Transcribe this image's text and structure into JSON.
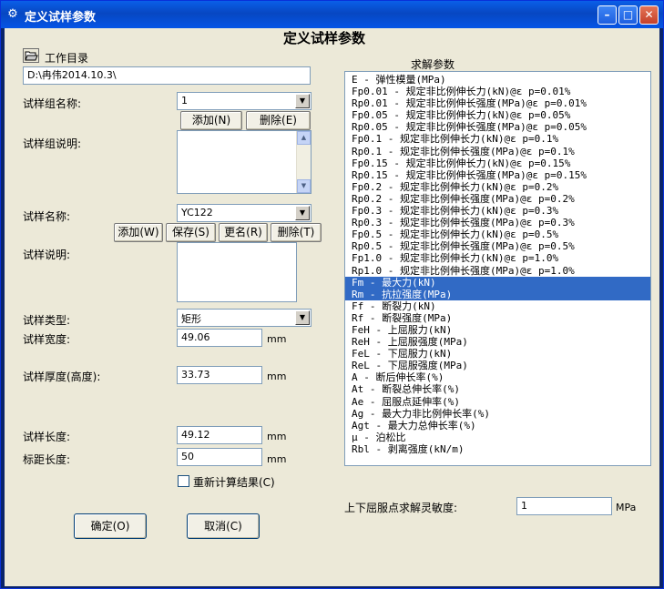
{
  "window": {
    "title": "定义试样参数",
    "app_icon": "settings-icon"
  },
  "form": {
    "heading": "定义试样参数",
    "work_dir": {
      "label": "工作目录",
      "icon": "folder-open-icon",
      "value": "D:\\冉伟2014.10.3\\"
    },
    "group_name": {
      "label": "试样组名称:",
      "value": "1",
      "add": "添加(N)",
      "delete": "删除(E)"
    },
    "group_desc": {
      "label": "试样组说明:"
    },
    "sample_name": {
      "label": "试样名称:",
      "value": "YC122",
      "add": "添加(W)",
      "save": "保存(S)",
      "rename": "更名(R)",
      "delete": "删除(T)"
    },
    "sample_desc": {
      "label": "试样说明:"
    },
    "sample_type": {
      "label": "试样类型:",
      "value": "矩形"
    },
    "width": {
      "label": "试样宽度:",
      "value": "49.06",
      "unit": "mm"
    },
    "thickness": {
      "label": "试样厚度(高度):",
      "value": "33.73",
      "unit": "mm"
    },
    "length": {
      "label": "试样长度:",
      "value": "49.12",
      "unit": "mm"
    },
    "gauge_length": {
      "label": "标距长度:",
      "value": "50",
      "unit": "mm"
    },
    "recalc": {
      "label": "重新计算结果(C)",
      "checked": false
    },
    "ok": "确定(O)",
    "cancel": "取消(C)"
  },
  "params": {
    "title": "求解参数",
    "items": [
      "E - 弹性模量(MPa)",
      "Fp0.01 - 规定非比例伸长力(kN)@ε p=0.01%",
      "Rp0.01 - 规定非比例伸长强度(MPa)@ε p=0.01%",
      "Fp0.05 - 规定非比例伸长力(kN)@ε p=0.05%",
      "Rp0.05 - 规定非比例伸长强度(MPa)@ε p=0.05%",
      "Fp0.1 - 规定非比例伸长力(kN)@ε p=0.1%",
      "Rp0.1 - 规定非比例伸长强度(MPa)@ε p=0.1%",
      "Fp0.15 - 规定非比例伸长力(kN)@ε p=0.15%",
      "Rp0.15 - 规定非比例伸长强度(MPa)@ε p=0.15%",
      "Fp0.2 - 规定非比例伸长力(kN)@ε p=0.2%",
      "Rp0.2 - 规定非比例伸长强度(MPa)@ε p=0.2%",
      "Fp0.3 - 规定非比例伸长力(kN)@ε p=0.3%",
      "Rp0.3 - 规定非比例伸长强度(MPa)@ε p=0.3%",
      "Fp0.5 - 规定非比例伸长力(kN)@ε p=0.5%",
      "Rp0.5 - 规定非比例伸长强度(MPa)@ε p=0.5%",
      "Fp1.0 - 规定非比例伸长力(kN)@ε p=1.0%",
      "Rp1.0 - 规定非比例伸长强度(MPa)@ε p=1.0%",
      "Fm - 最大力(kN)",
      "Rm - 抗拉强度(MPa)",
      "Ff - 断裂力(kN)",
      "Rf - 断裂强度(MPa)",
      "FeH - 上屈服力(kN)",
      "ReH - 上屈服强度(MPa)",
      "FeL - 下屈服力(kN)",
      "ReL - 下屈服强度(MPa)",
      "A - 断后伸长率(%)",
      "At - 断裂总伸长率(%)",
      "Ae - 屈服点延伸率(%)",
      "Ag - 最大力非比例伸长率(%)",
      "Agt - 最大力总伸长率(%)",
      "μ - 泊松比",
      "Rbl - 剥离强度(kN/m)"
    ],
    "selected": [
      17,
      18
    ],
    "sensitivity": {
      "label": "上下屈服点求解灵敏度:",
      "value": "1",
      "unit": "MPa"
    }
  }
}
